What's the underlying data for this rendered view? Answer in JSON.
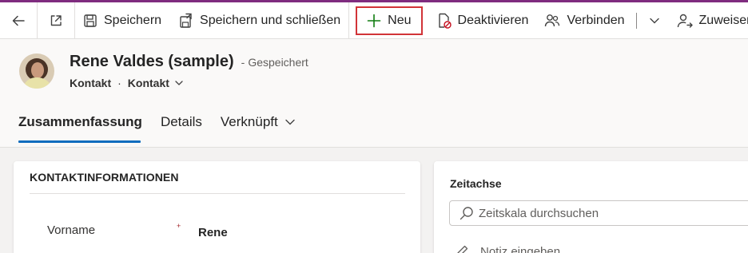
{
  "commandbar": {
    "back_icon": "back-arrow-icon",
    "popout_icon": "open-in-new-window-icon",
    "save_label": "Speichern",
    "save_close_label": "Speichern und schließen",
    "new_label": "Neu",
    "deactivate_label": "Deaktivieren",
    "connect_label": "Verbinden",
    "assign_label": "Zuweisen"
  },
  "record": {
    "title": "Rene Valdes (sample)",
    "separator": "-",
    "status": "Gespeichert",
    "entity": "Kontakt",
    "dot": "·",
    "form": "Kontakt"
  },
  "tabs": [
    {
      "label": "Zusammenfassung",
      "active": true
    },
    {
      "label": "Details"
    },
    {
      "label": "Verknüpft"
    }
  ],
  "contact_section": {
    "title": "KONTAKTINFORMATIONEN",
    "fields": [
      {
        "label": "Vorname",
        "required_mark": "+",
        "value": "Rene"
      }
    ]
  },
  "timeline": {
    "title": "Zeitachse",
    "search_placeholder": "Zeitskala durchsuchen",
    "note_placeholder": "Notiz eingeben"
  },
  "colors": {
    "accent": "#0f6cbd",
    "highlight_border": "#d13438",
    "top_stripe": "#7f2c7f"
  }
}
